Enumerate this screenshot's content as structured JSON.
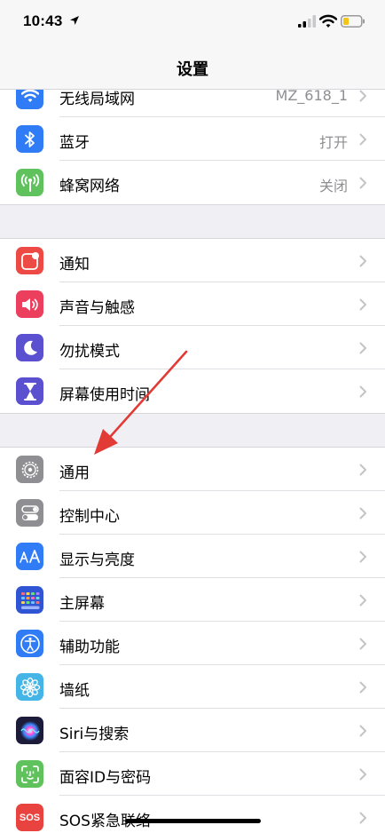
{
  "status_bar": {
    "time": "10:43"
  },
  "nav": {
    "title": "设置"
  },
  "groups": [
    {
      "items": [
        {
          "label": "无线局域网",
          "value": "MZ_618_1",
          "icon": "wifi-icon",
          "color": "#2f7cf6"
        },
        {
          "label": "蓝牙",
          "value": "打开",
          "icon": "bluetooth-icon",
          "color": "#2f7cf6"
        },
        {
          "label": "蜂窝网络",
          "value": "关闭",
          "icon": "antenna-icon",
          "color": "#5fc25d"
        }
      ]
    },
    {
      "items": [
        {
          "label": "通知",
          "icon": "notification-icon",
          "color": "#ee4a45"
        },
        {
          "label": "声音与触感",
          "icon": "speaker-icon",
          "color": "#ec3f5d"
        },
        {
          "label": "勿扰模式",
          "icon": "moon-icon",
          "color": "#5a50d0"
        },
        {
          "label": "屏幕使用时间",
          "icon": "hourglass-icon",
          "color": "#5a50d0"
        }
      ]
    },
    {
      "items": [
        {
          "label": "通用",
          "icon": "gear-icon",
          "color": "#8e8e93"
        },
        {
          "label": "控制中心",
          "icon": "toggle-switches-icon",
          "color": "#8e8e93"
        },
        {
          "label": "显示与亮度",
          "icon": "text-size-icon",
          "color": "#2f7cf6"
        },
        {
          "label": "主屏幕",
          "icon": "app-grid-icon",
          "color": "#2f55d4"
        },
        {
          "label": "辅助功能",
          "icon": "accessibility-icon",
          "color": "#2f7cf6"
        },
        {
          "label": "墙纸",
          "icon": "flower-icon",
          "color": "#45b4e6"
        },
        {
          "label": "Siri与搜索",
          "icon": "siri-icon",
          "color": "#1c1c3a"
        },
        {
          "label": "面容ID与密码",
          "icon": "face-id-icon",
          "color": "#5fc25d"
        },
        {
          "label": "SOS紧急联络",
          "icon": "sos-icon",
          "icon_text": "SOS",
          "color": "#e8433f"
        }
      ]
    }
  ],
  "annotation": {
    "color": "#e23b36"
  }
}
